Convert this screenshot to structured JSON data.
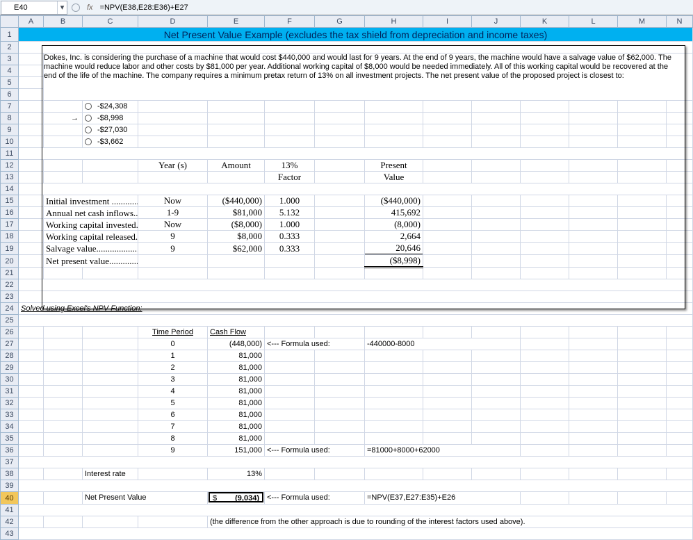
{
  "namebox": "E40",
  "formula": "=NPV(E38,E28:E36)+E27",
  "fx_label": "fx",
  "cols": [
    "A",
    "B",
    "C",
    "D",
    "E",
    "F",
    "G",
    "H",
    "I",
    "J",
    "K",
    "L",
    "M",
    "N"
  ],
  "title": "Net Present Value Example (excludes the tax shield from depreciation and income taxes)",
  "problem_text": "Dokes, Inc. is considering the purchase of a machine that would cost $440,000 and would last for 9 years. At the end of 9 years, the machine would have a salvage value of $62,000. The machine would reduce labor and other costs by $81,000 per year. Additional working capital of $8,000 would be needed immediately. All of this working capital would be recovered at the end of the life of the machine. The company requires a minimum pretax return of 13% on all investment projects. The net present value of the proposed project is closest to:",
  "options": {
    "a": "-$24,308",
    "b": "-$8,998",
    "c": "-$27,030",
    "d": "-$3,662"
  },
  "headers": {
    "year": "Year (s)",
    "amount": "Amount",
    "factor_top": "13%",
    "factor_bot": "Factor",
    "pv_top": "Present",
    "pv_bot": "Value"
  },
  "rows": {
    "r15": {
      "label": "Initial investment ..............",
      "year": "Now",
      "amount": "($440,000)",
      "factor": "1.000",
      "pv": "($440,000)"
    },
    "r16": {
      "label": "Annual net cash inflows....",
      "year": "1-9",
      "amount": "$81,000",
      "factor": "5.132",
      "pv": "415,692"
    },
    "r17": {
      "label": "Working capital invested..",
      "year": "Now",
      "amount": "($8,000)",
      "factor": "1.000",
      "pv": "(8,000)"
    },
    "r18": {
      "label": "Working capital released..",
      "year": "9",
      "amount": "$8,000",
      "factor": "0.333",
      "pv": "2,664"
    },
    "r19": {
      "label": "Salvage value.....................",
      "year": "9",
      "amount": "$62,000",
      "factor": "0.333",
      "pv": "20,646"
    },
    "r20": {
      "label": "Net present value..............",
      "pv": "($8,998)"
    }
  },
  "solved_label": "Solved using Excel's NPV Function:",
  "tp_hdr": "Time Period",
  "cf_hdr": "Cash Flow",
  "cf": {
    "r27": {
      "tp": "0",
      "cf": "(448,000)",
      "note": "<--- Formula used:",
      "formula": "-440000-8000"
    },
    "r28": {
      "tp": "1",
      "cf": "81,000"
    },
    "r29": {
      "tp": "2",
      "cf": "81,000"
    },
    "r30": {
      "tp": "3",
      "cf": "81,000"
    },
    "r31": {
      "tp": "4",
      "cf": "81,000"
    },
    "r32": {
      "tp": "5",
      "cf": "81,000"
    },
    "r33": {
      "tp": "6",
      "cf": "81,000"
    },
    "r34": {
      "tp": "7",
      "cf": "81,000"
    },
    "r35": {
      "tp": "8",
      "cf": "81,000"
    },
    "r36": {
      "tp": "9",
      "cf": "151,000",
      "note": "<--- Formula used:",
      "formula": "=81000+8000+62000"
    }
  },
  "ir_label": "Interest rate",
  "ir_value": "13%",
  "npv_label": "Net Present Value",
  "npv_value": "(9,034)",
  "npv_dollar": "$",
  "npv_note": "<--- Formula used:",
  "npv_formula": "=NPV(E37,E27:E35)+E26",
  "footnote": "(the difference from the other approach is due to rounding of the interest factors used above)."
}
